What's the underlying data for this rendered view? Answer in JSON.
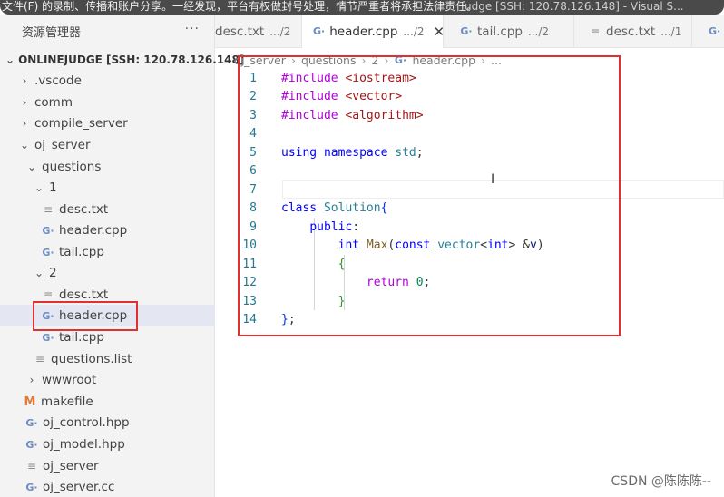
{
  "banner": {
    "left_text": "文件(F) 的录制、传播和账户分享。一经发现，平台有权做封号处理，情节严重者将承担法律责任。",
    "right_text": "udge [SSH: 120.78.126.148] - Visual S..."
  },
  "sidebar": {
    "title": "资源管理器",
    "more": "···",
    "items": [
      {
        "label": "ONLINEJUDGE [SSH: 120.78.126.148]",
        "chevron": "⌄",
        "icon": "",
        "kind": "root"
      },
      {
        "label": ".vscode",
        "chevron": "›",
        "icon": "",
        "kind": "folder"
      },
      {
        "label": "comm",
        "chevron": "›",
        "icon": "",
        "kind": "folder"
      },
      {
        "label": "compile_server",
        "chevron": "›",
        "icon": "",
        "kind": "folder"
      },
      {
        "label": "oj_server",
        "chevron": "⌄",
        "icon": "",
        "kind": "folder"
      },
      {
        "label": "questions",
        "chevron": "⌄",
        "icon": "",
        "kind": "folder"
      },
      {
        "label": "1",
        "chevron": "⌄",
        "icon": "",
        "kind": "folder"
      },
      {
        "label": "desc.txt",
        "chevron": "",
        "icon": "≡",
        "kind": "txt"
      },
      {
        "label": "header.cpp",
        "chevron": "",
        "icon": "G·",
        "kind": "cpp"
      },
      {
        "label": "tail.cpp",
        "chevron": "",
        "icon": "G·",
        "kind": "cpp"
      },
      {
        "label": "2",
        "chevron": "⌄",
        "icon": "",
        "kind": "folder"
      },
      {
        "label": "desc.txt",
        "chevron": "",
        "icon": "≡",
        "kind": "txt"
      },
      {
        "label": "header.cpp",
        "chevron": "",
        "icon": "G·",
        "kind": "cpp"
      },
      {
        "label": "tail.cpp",
        "chevron": "",
        "icon": "G·",
        "kind": "cpp"
      },
      {
        "label": "questions.list",
        "chevron": "",
        "icon": "≡",
        "kind": "txt"
      },
      {
        "label": "wwwroot",
        "chevron": "›",
        "icon": "",
        "kind": "folder"
      },
      {
        "label": "makefile",
        "chevron": "",
        "icon": "M",
        "kind": "make"
      },
      {
        "label": "oj_control.hpp",
        "chevron": "",
        "icon": "G·",
        "kind": "cpp"
      },
      {
        "label": "oj_model.hpp",
        "chevron": "",
        "icon": "G·",
        "kind": "cpp"
      },
      {
        "label": "oj_server",
        "chevron": "",
        "icon": "≡",
        "kind": "txt"
      },
      {
        "label": "oj_server.cc",
        "chevron": "",
        "icon": "G·",
        "kind": "cpp"
      }
    ]
  },
  "tabs": [
    {
      "label": "desc.txt",
      "path": ".../2",
      "icon": "",
      "active": false
    },
    {
      "label": "header.cpp",
      "path": ".../2",
      "icon": "G·",
      "active": true,
      "close": "✕"
    },
    {
      "label": "tail.cpp",
      "path": ".../2",
      "icon": "G·",
      "active": false
    },
    {
      "label": "desc.txt",
      "path": ".../1",
      "icon": "≡",
      "active": false
    },
    {
      "label": "",
      "path": "",
      "icon": "G·",
      "active": false
    }
  ],
  "breadcrumb": [
    "oj_server",
    "questions",
    "2",
    "header.cpp",
    "..."
  ],
  "breadcrumb_icon": "G·",
  "editor": {
    "line_numbers": [
      "1",
      "2",
      "3",
      "4",
      "5",
      "6",
      "7",
      "8",
      "9",
      "10",
      "11",
      "12",
      "13",
      "14"
    ]
  },
  "watermark": "CSDN @陈陈陈--",
  "colors": {
    "highlight_box": "#e03030",
    "selected_row": "#e4e6f1"
  }
}
